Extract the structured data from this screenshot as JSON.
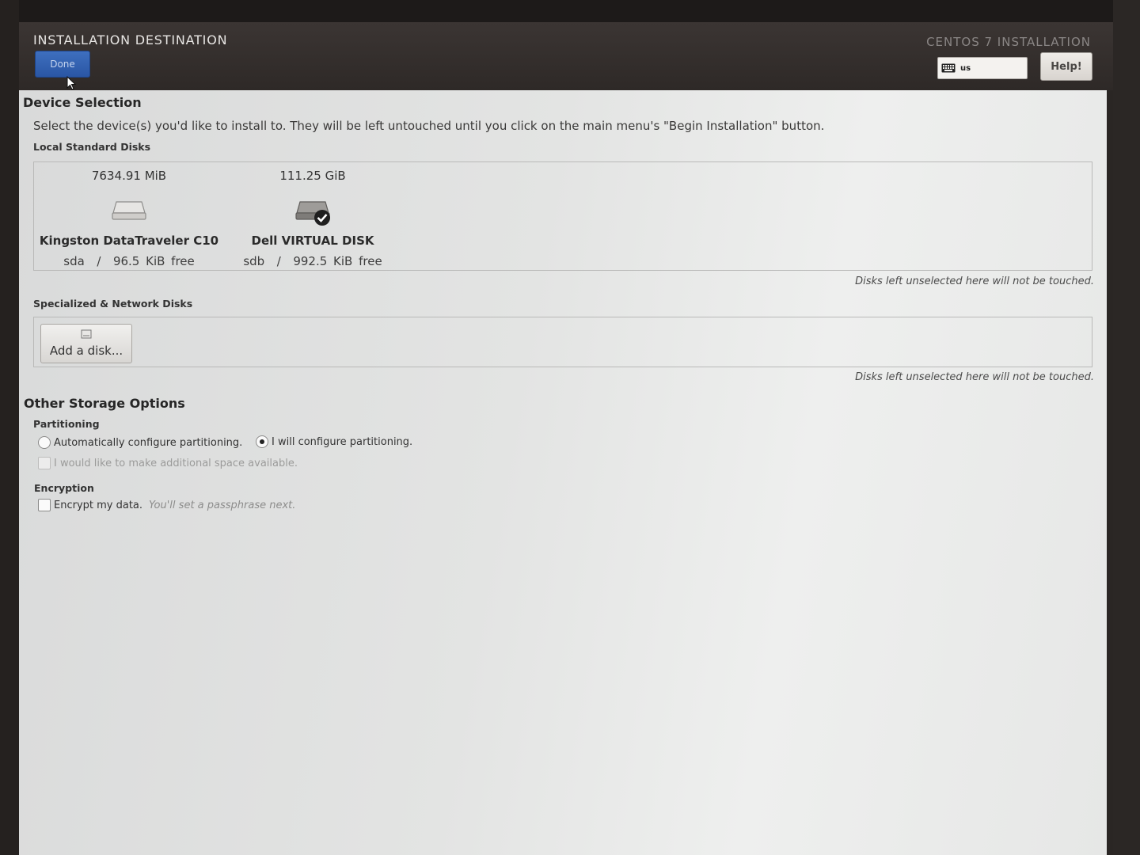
{
  "header": {
    "title": "INSTALLATION DESTINATION",
    "done_label": "Done",
    "brand": "CENTOS 7 INSTALLATION",
    "keyboard_layout": "us",
    "help_label": "Help!"
  },
  "device_selection": {
    "heading": "Device Selection",
    "description": "Select the device(s) you'd like to install to.  They will be left untouched until you click on the main menu's \"Begin Installation\" button.",
    "local_label": "Local Standard Disks",
    "disks": [
      {
        "size": "7634.91 MiB",
        "name": "Kingston DataTraveler C10",
        "device": "sda",
        "separator": "/",
        "free": "96.5 KiB free",
        "selected": false
      },
      {
        "size": "111.25 GiB",
        "name": "Dell VIRTUAL DISK",
        "device": "sdb",
        "separator": "/",
        "free": "992.5 KiB free",
        "selected": true
      }
    ],
    "note_local": "Disks left unselected here will not be touched.",
    "network_label": "Specialized & Network Disks",
    "add_disk_label": "Add a disk...",
    "note_network": "Disks left unselected here will not be touched."
  },
  "other_storage": {
    "heading": "Other Storage Options",
    "partitioning_label": "Partitioning",
    "auto_label": "Automatically configure partitioning.",
    "manual_label": "I will configure partitioning.",
    "selected_option": "manual",
    "space_label": "I would like to make additional space available.",
    "encryption_label": "Encryption",
    "encrypt_label": "Encrypt my data.",
    "encrypt_hint": "You'll set a passphrase next."
  },
  "icons": [
    "keyboard-icon",
    "disk-icon",
    "selected-check-icon",
    "add-disk-icon",
    "mouse-cursor-icon"
  ]
}
